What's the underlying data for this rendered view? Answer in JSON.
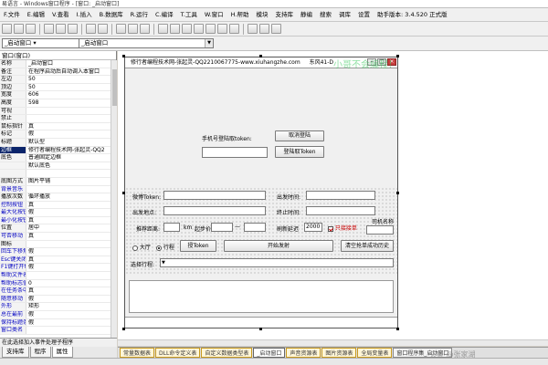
{
  "window": {
    "title": "易语言 - Windows窗口程序 - [窗口: _启动窗口]"
  },
  "menu": [
    "F.文件",
    "E.编辑",
    "V.查看",
    "I.插入",
    "B.数据库",
    "R.运行",
    "C.编译",
    "T.工具",
    "W.窗口",
    "H.帮助",
    "模块",
    "支持库",
    "静编",
    "搜索",
    "调库",
    "设置",
    "助手版本: 3.4.520 正式版"
  ],
  "selectors": {
    "left": "_启动窗口 ▾",
    "right": "_启动窗口"
  },
  "props_header": "窗口(窗口)",
  "props": [
    {
      "name": "名称",
      "value": "_启动窗口",
      "blue": false
    },
    {
      "name": "备注",
      "value": "在程序启动后自动调入本窗口",
      "blue": false
    },
    {
      "name": "左边",
      "value": "50",
      "blue": false
    },
    {
      "name": "顶边",
      "value": "50",
      "blue": false
    },
    {
      "name": "宽度",
      "value": "606",
      "blue": false
    },
    {
      "name": "高度",
      "value": "598",
      "blue": false
    },
    {
      "name": "可视",
      "value": "",
      "blue": false
    },
    {
      "name": "禁止",
      "value": "",
      "blue": false
    },
    {
      "name": "鼠标指针",
      "value": "真",
      "blue": false
    },
    {
      "name": "标记",
      "value": "假",
      "blue": false
    },
    {
      "name": "标题",
      "value": "默认型",
      "blue": false
    },
    {
      "name": "边框",
      "value": "修行者编程技术网-张起灵-QQ2",
      "blue": false,
      "selected": true
    },
    {
      "name": "底色",
      "value": "普通固定边框",
      "blue": false
    },
    {
      "name": "",
      "value": "默认底色",
      "blue": false
    },
    {
      "name": "",
      "value": "",
      "blue": false
    },
    {
      "name": "底图方式",
      "value": "图片平铺",
      "blue": false
    },
    {
      "name": "背景音乐",
      "value": "",
      "blue": true
    },
    {
      "name": "播放次数",
      "value": "循环播放",
      "blue": false
    },
    {
      "name": "控制按钮",
      "value": "真",
      "blue": true
    },
    {
      "name": "最大化按钮",
      "value": "假",
      "blue": true
    },
    {
      "name": "最小化按钮",
      "value": "真",
      "blue": true
    },
    {
      "name": "位置",
      "value": "居中",
      "blue": false
    },
    {
      "name": "可否移动",
      "value": "真",
      "blue": true
    },
    {
      "name": "图标",
      "value": "",
      "blue": false
    },
    {
      "name": "回车下移焦点",
      "value": "假",
      "blue": true
    },
    {
      "name": "Esc键关闭",
      "value": "真",
      "blue": true
    },
    {
      "name": "F1键打开帮助",
      "value": "假",
      "blue": true
    },
    {
      "name": "帮助文件名",
      "value": "",
      "blue": true
    },
    {
      "name": "帮助标志值",
      "value": "0",
      "blue": true
    },
    {
      "name": "在任务条中显示",
      "value": "真",
      "blue": true
    },
    {
      "name": "随意移动",
      "value": "假",
      "blue": true
    },
    {
      "name": "外形",
      "value": "矩形",
      "blue": true
    },
    {
      "name": "总在最前",
      "value": "假",
      "blue": true
    },
    {
      "name": "保持标题条激活",
      "value": "假",
      "blue": true
    },
    {
      "name": "窗口类名",
      "value": "",
      "blue": true
    }
  ],
  "props_desc": "在此选择加入事件处理子程序",
  "panel_tabs": [
    "支持库",
    "程序",
    "属性"
  ],
  "form": {
    "title": "修行者编程技术网-张起灵-QQ2210067775-www.xiuhangzhe.com",
    "title_right": "东风41-D",
    "phone_label": "手机号登陆取token:",
    "btn_cancel_login": "取消登陆",
    "btn_get_token": "登陆取Token",
    "lbl_username": "微博Token:",
    "lbl_start_time": "出发时间:",
    "lbl_departure": "出发地点:",
    "lbl_end_time": "终止时间:",
    "lbl_fleet_distance": "推荐距离:",
    "lbl_km": "km",
    "lbl_price": "起步价",
    "lbl_refresh": "刷新延迟",
    "refresh_value": "2000",
    "lbl_only_take": "只接接单",
    "lbl_driver_name": "司机名称",
    "radio_big": "大厅",
    "radio_trip": "行程",
    "btn_claim_token": "授Token",
    "btn_start": "开始发射",
    "btn_clear_history": "清空抢单成功历史",
    "lbl_select_trip": "选择行程:"
  },
  "bottom_tabs": [
    "常量数据表",
    "DLL命令定义表",
    "自定义数据类型表",
    "_启动窗口",
    "声音资源表",
    "图片资源表",
    "全局变量表",
    "窗口程序集_启动窗口"
  ],
  "watermarks": {
    "top": "小哥不会编程！",
    "bottom": "头条 @张家湖"
  }
}
